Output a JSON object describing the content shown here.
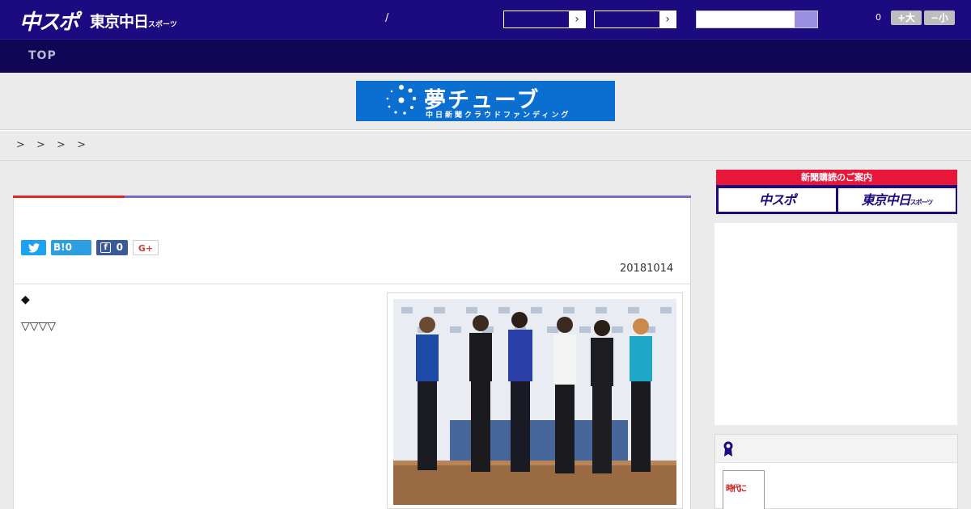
{
  "header": {
    "logo_chuspo": "中スポ",
    "logo_tokyo": "東京中日",
    "logo_tokyo_small": "スポーツ",
    "slash": "/",
    "select_arrow_1": "›",
    "select_arrow_2": "›",
    "search_placeholder": "",
    "count": "0",
    "font_larger": "+大",
    "font_smaller": "−小"
  },
  "nav": {
    "top": "TOP"
  },
  "banner": {
    "title": "夢チューブ",
    "subtitle": "中日新聞クラウドファンディング"
  },
  "breadcrumbs": "> > > >",
  "article": {
    "share": {
      "twitter_icon": "twitter-icon",
      "hatena": "B!0",
      "facebook_icon": "f",
      "facebook_count": "0",
      "googleplus": "G+"
    },
    "date": "20181014",
    "diamond": "◆",
    "triangles": "▽▽▽▽"
  },
  "sidebar": {
    "subscribe_header": "新聞購読のご案内",
    "subscribe_chuspo": "中スポ",
    "subscribe_tokyo": "東京中日",
    "subscribe_tokyo_small": "スポーツ",
    "jidai_main": "時代",
    "jidai_mark": "に"
  },
  "colors": {
    "header_bg": "#1c0a80",
    "nav_bg": "#110655",
    "accent_red": "#e0242a",
    "accent_purple": "#7b6cc4",
    "banner_blue": "#0b6fd1"
  }
}
